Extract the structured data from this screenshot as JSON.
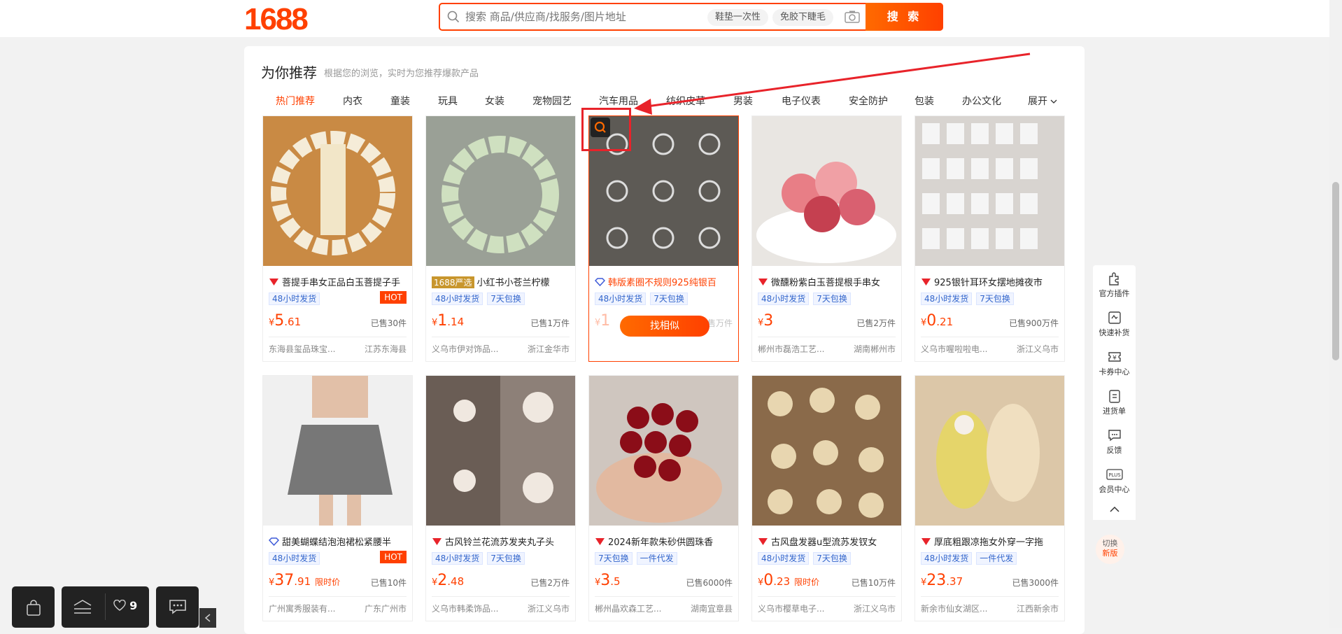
{
  "header": {
    "logo": "1688",
    "search_placeholder": "搜索 商品/供应商/找服务/图片地址",
    "chips": [
      "鞋垫一次性",
      "免胶下睫毛"
    ],
    "search_button": "搜 索"
  },
  "recommend": {
    "title": "为你推荐",
    "subtitle": "根据您的浏览，实时为您推荐爆款产品",
    "categories": [
      "热门推荐",
      "内衣",
      "童装",
      "玩具",
      "女装",
      "宠物园艺",
      "汽车用品",
      "纺织皮革",
      "男装",
      "电子仪表",
      "安全防护",
      "包装",
      "办公文化",
      "展开"
    ],
    "find_similar": "找相似"
  },
  "products": [
    {
      "title": "菩提手串女正品白玉菩提子手",
      "badge": "",
      "tags": [
        "48小时发货"
      ],
      "hot": "HOT",
      "currency": "¥",
      "price_int": "5",
      "price_frac": ".61",
      "limit": "",
      "sold": "已售30件",
      "shop": "东海县玺品珠宝...",
      "location": "江苏东海县"
    },
    {
      "title": "小红书小苍兰柠檬",
      "badge": "1688严选",
      "tags": [
        "48小时发货",
        "7天包换"
      ],
      "hot": "",
      "currency": "¥",
      "price_int": "1",
      "price_frac": ".14",
      "limit": "",
      "sold": "已售1万件",
      "shop": "义乌市伊对饰品...",
      "location": "浙江金华市"
    },
    {
      "title": "韩版素圈不规则925纯银百",
      "badge": "",
      "tags": [
        "48小时发货",
        "7天包换"
      ],
      "hot": "",
      "currency": "¥",
      "price_int": "1",
      "price_frac": "",
      "limit": "",
      "sold": "已售万件",
      "shop": "",
      "location": ""
    },
    {
      "title": "微醺粉紫白玉菩提根手串女",
      "badge": "",
      "tags": [
        "48小时发货",
        "7天包换"
      ],
      "hot": "",
      "currency": "¥",
      "price_int": "3",
      "price_frac": "",
      "limit": "",
      "sold": "已售2万件",
      "shop": "郴州市磊浩工艺...",
      "location": "湖南郴州市"
    },
    {
      "title": "925银针耳环女摆地摊夜市",
      "badge": "",
      "tags": [
        "48小时发货",
        "7天包换"
      ],
      "hot": "",
      "currency": "¥",
      "price_int": "0",
      "price_frac": ".21",
      "limit": "",
      "sold": "已售900万件",
      "shop": "义乌市喔啦啦电...",
      "location": "浙江义乌市"
    },
    {
      "title": "甜美蝴蝶结泡泡裙松紧腰半",
      "badge": "",
      "tags": [
        "48小时发货"
      ],
      "hot": "HOT",
      "currency": "¥",
      "price_int": "37",
      "price_frac": ".91",
      "limit": "限时价",
      "sold": "已售10件",
      "shop": "广州寓秀服装有...",
      "location": "广东广州市"
    },
    {
      "title": "古风铃兰花流苏发夹丸子头",
      "badge": "",
      "tags": [
        "48小时发货",
        "7天包换"
      ],
      "hot": "",
      "currency": "¥",
      "price_int": "2",
      "price_frac": ".48",
      "limit": "",
      "sold": "已售2万件",
      "shop": "义乌市韩柔饰品...",
      "location": "浙江义乌市"
    },
    {
      "title": "2024新年款朱砂供圆珠香",
      "badge": "",
      "tags": [
        "7天包换",
        "一件代发"
      ],
      "hot": "",
      "currency": "¥",
      "price_int": "3",
      "price_frac": ".5",
      "limit": "",
      "sold": "已售6000件",
      "shop": "郴州晶欢森工艺...",
      "location": "湖南宜章县"
    },
    {
      "title": "古风盘发器u型流苏发钗女",
      "badge": "",
      "tags": [
        "48小时发货",
        "7天包换"
      ],
      "hot": "",
      "currency": "¥",
      "price_int": "0",
      "price_frac": ".23",
      "limit": "限时价",
      "sold": "已售10万件",
      "shop": "义乌市樱草电子...",
      "location": "浙江义乌市"
    },
    {
      "title": "厚底粗跟凉拖女外穿一字拖",
      "badge": "",
      "tags": [
        "48小时发货",
        "一件代发"
      ],
      "hot": "",
      "currency": "¥",
      "price_int": "23",
      "price_frac": ".37",
      "limit": "",
      "sold": "已售3000件",
      "shop": "新余市仙女湖区...",
      "location": "江西新余市"
    }
  ],
  "sidebar": {
    "items": [
      "官方插件",
      "快速补货",
      "卡券中心",
      "进货单",
      "反馈",
      "会员中心"
    ],
    "switch_top": "切换",
    "switch_bottom": "新版"
  },
  "bottom": {
    "favorites_count": "9"
  }
}
